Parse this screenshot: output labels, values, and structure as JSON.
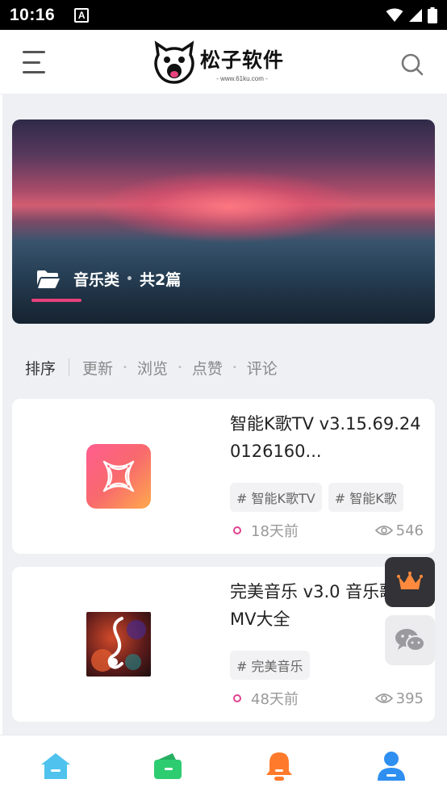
{
  "status_bar": {
    "time": "10:16",
    "notification_icon_letter": "A"
  },
  "header": {
    "logo_title": "松子软件",
    "logo_subtitle": "- www.61ku.com -"
  },
  "banner": {
    "category": "音乐类",
    "separator": "•",
    "count": "共2篇",
    "accent_color": "#e8417d"
  },
  "sort_bar": {
    "title": "排序",
    "options": [
      "更新",
      "浏览",
      "点赞",
      "评论"
    ],
    "separator": "•"
  },
  "posts": [
    {
      "title": "智能K歌TV v3.15.69.240126160...",
      "tags": [
        "# 智能K歌TV",
        "# 智能K歌"
      ],
      "time": "18天前",
      "views": "546"
    },
    {
      "title": "完美音乐 v3.0 音乐歌曲MV大全",
      "tags": [
        "# 完美音乐"
      ],
      "time": "48天前",
      "views": "395"
    }
  ],
  "floating": [
    "crown-icon",
    "wechat-icon"
  ],
  "bottom_nav": [
    "home-icon",
    "wallet-icon",
    "bell-icon",
    "user-icon"
  ],
  "colors": {
    "home": "#4fc3ee",
    "wallet": "#2ecc71",
    "bell": "#ff7a2b",
    "user": "#2e8ff0",
    "crown": "#ff8a3d"
  }
}
